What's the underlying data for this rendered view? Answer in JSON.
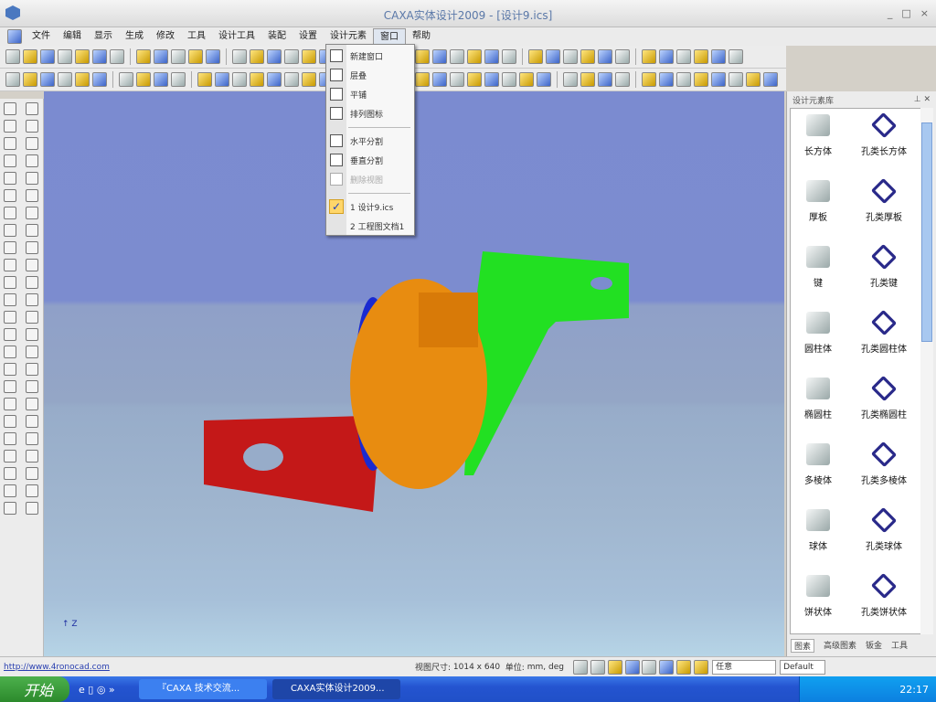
{
  "window": {
    "title": "CAXA实体设计2009 - [设计9.ics]",
    "controls": [
      "_",
      "□",
      "×"
    ]
  },
  "menubar": [
    "文件",
    "编辑",
    "显示",
    "生成",
    "修改",
    "工具",
    "设计工具",
    "装配",
    "设置",
    "设计元素",
    "窗口",
    "帮助"
  ],
  "window_menu": {
    "items": [
      {
        "label": "新建窗口",
        "icon": "new-window-icon",
        "enabled": true
      },
      {
        "label": "层叠",
        "icon": "cascade-icon",
        "enabled": true
      },
      {
        "label": "平铺",
        "icon": "tile-icon",
        "enabled": true
      },
      {
        "label": "排列图标",
        "icon": "arrange-icons-icon",
        "enabled": true
      },
      {
        "label": "水平分割",
        "icon": "split-horizontal-icon",
        "enabled": true
      },
      {
        "label": "垂直分割",
        "icon": "split-vertical-icon",
        "enabled": true
      },
      {
        "label": "删除视图",
        "icon": "delete-view-icon",
        "enabled": false
      },
      {
        "label": "1 设计9.ics",
        "checked": true
      },
      {
        "label": "2 工程图文档1",
        "checked": false
      }
    ]
  },
  "viewport": {
    "axis_label": "Z"
  },
  "panel": {
    "title": "设计元素库",
    "items": [
      "长方体",
      "孔类长方体",
      "厚板",
      "孔类厚板",
      "键",
      "孔类键",
      "圆柱体",
      "孔类圆柱体",
      "椭圆柱",
      "孔类椭圆柱",
      "多棱体",
      "孔类多棱体",
      "球体",
      "孔类球体",
      "饼状体",
      "孔类饼状体"
    ],
    "tabs": [
      "图素",
      "高级图素",
      "钣金",
      "工具"
    ]
  },
  "status": {
    "url": "http://www.4ronocad.com",
    "view_size_label": "视图尺寸:",
    "view_size": "1014 x 640",
    "unit_label": "单位:",
    "unit": "mm, deg",
    "combo1": "任意",
    "combo2": "Default"
  },
  "taskbar": {
    "start": "开始",
    "tasks": [
      "『CAXA 技术交流...",
      "CAXA实体设计2009..."
    ],
    "clock": "22:17"
  },
  "colors": {
    "part_red": "#c41818",
    "part_green": "#22e022",
    "part_orange": "#e88c10",
    "part_blue": "#1a2ad0"
  }
}
